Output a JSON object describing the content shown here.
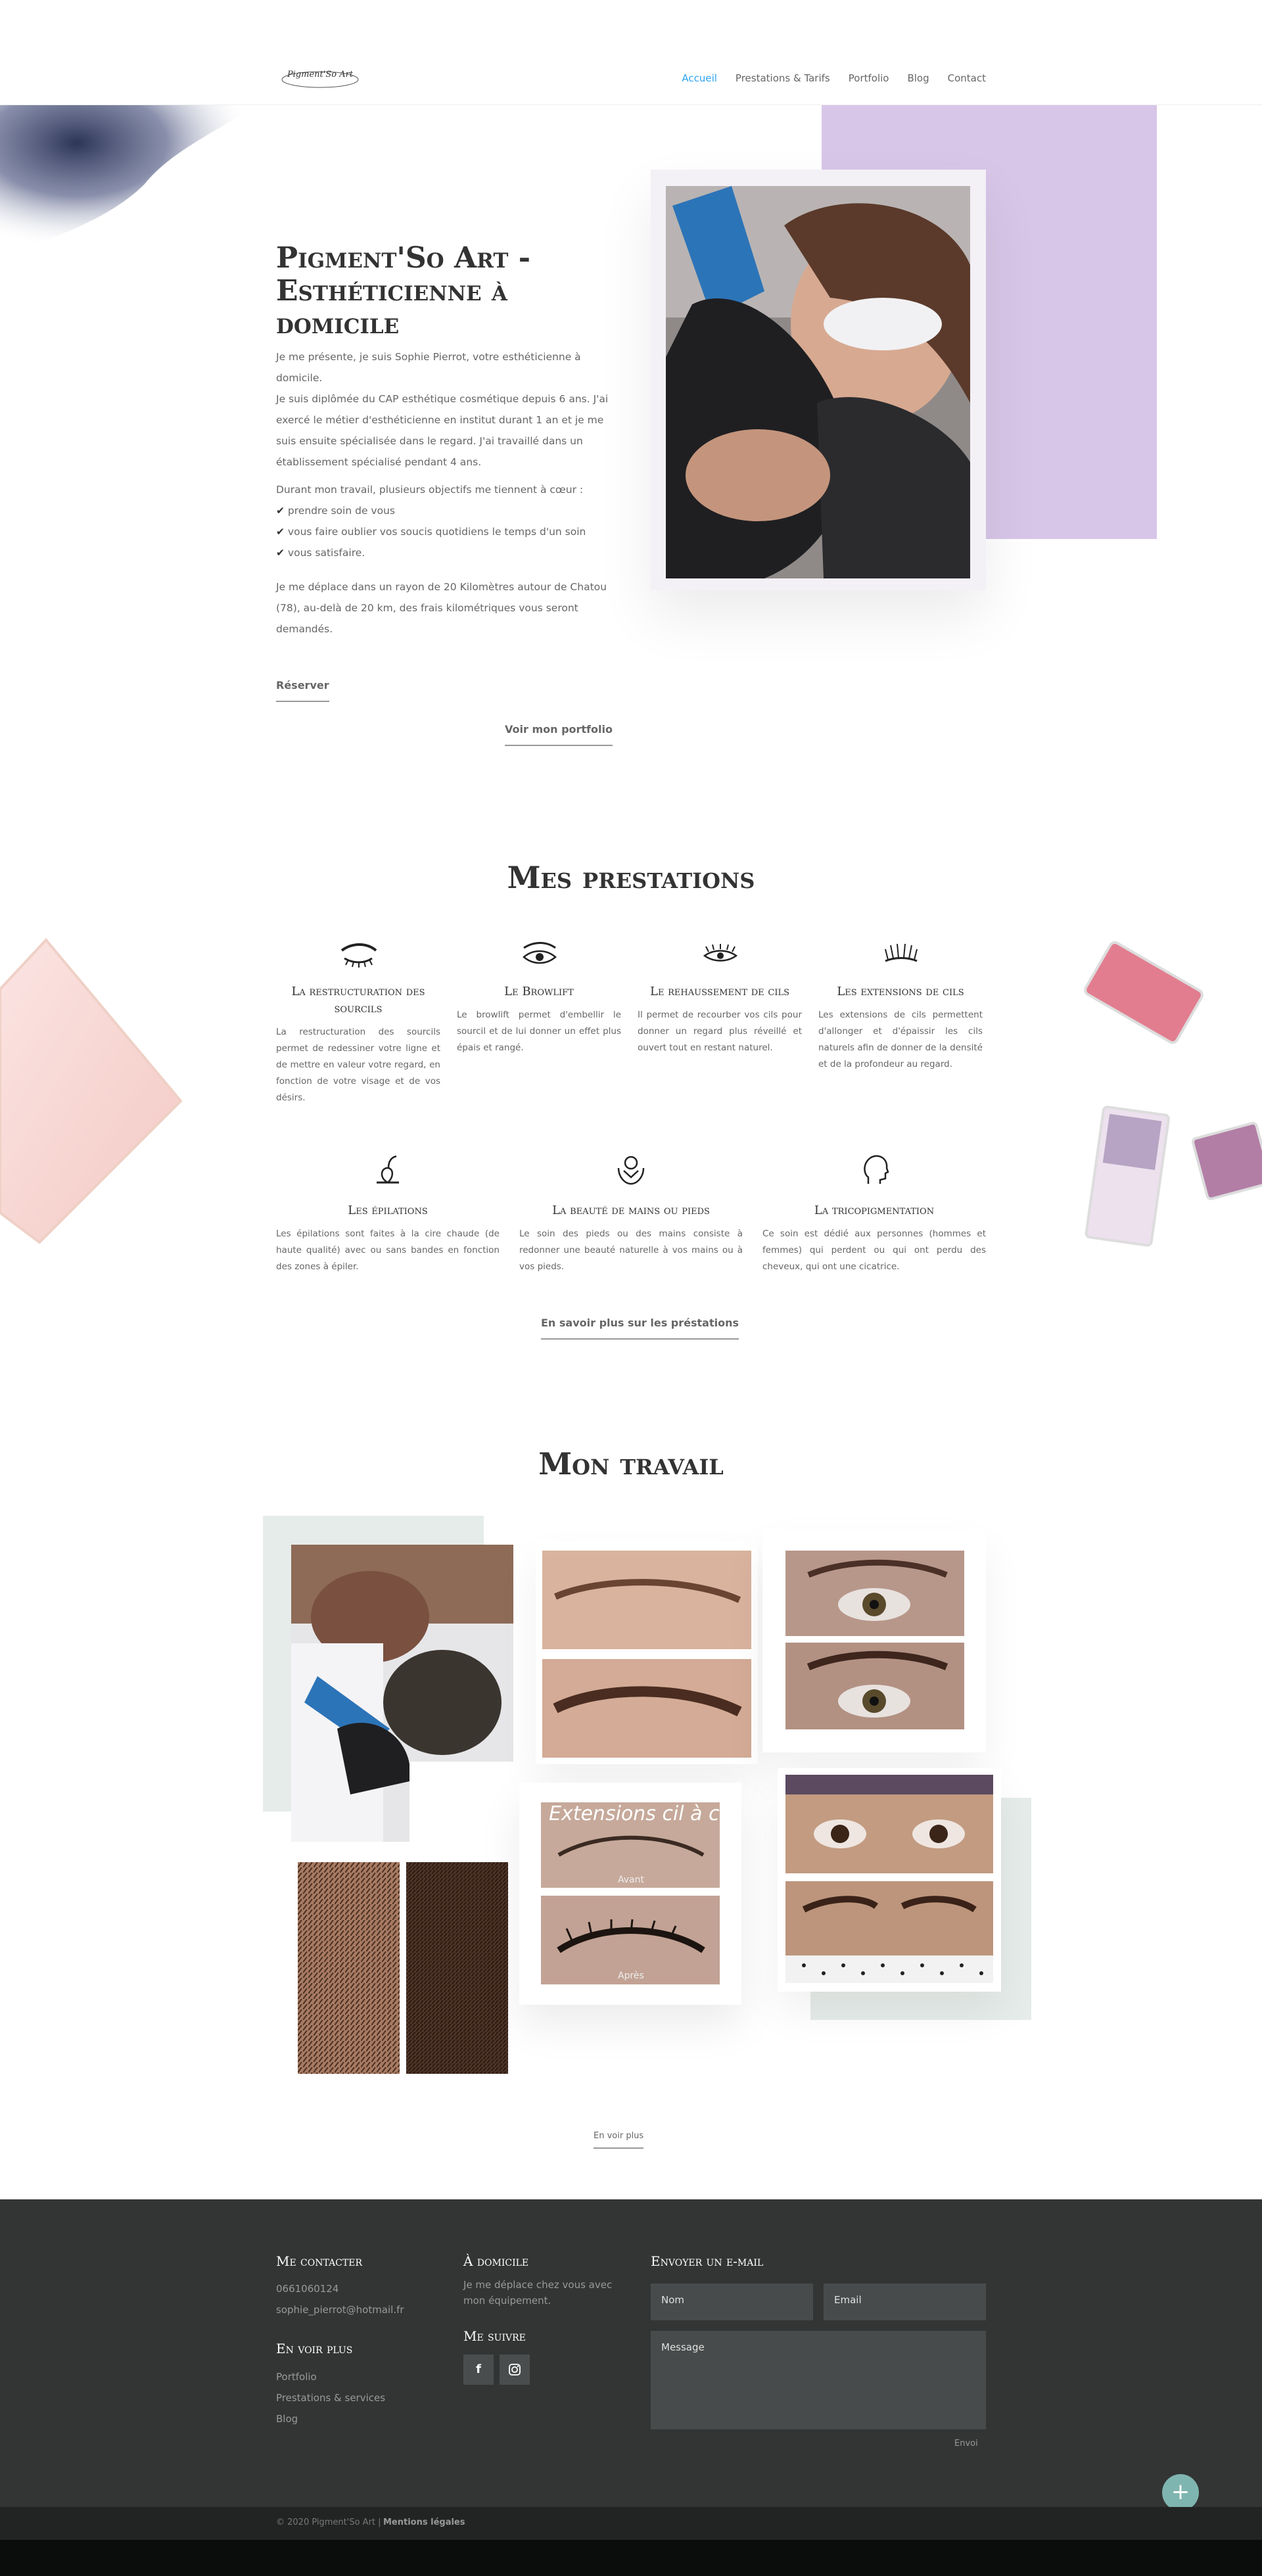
{
  "header": {
    "logo_text": "Pigment'So Art",
    "nav": [
      "Accueil",
      "Prestations & Tarifs",
      "Portfolio",
      "Blog",
      "Contact"
    ]
  },
  "hero": {
    "title": "Pigment'So Art - Esthéticienne à domicile",
    "intro_1": "Je me présente, je suis Sophie Pierrot, votre esthéticienne à domicile.",
    "intro_2": "Je suis diplômée du CAP esthétique cosmétique depuis 6 ans. J'ai exercé le métier d'esthéticienne en institut durant 1 an et je me suis ensuite spécialisée dans le regard. J'ai travaillé dans un établissement spécialisé pendant 4 ans.",
    "goals_intro": "Durant mon travail, plusieurs objectifs me tiennent à cœur :",
    "goals": [
      "prendre soin de vous",
      "vous faire oublier vos soucis quotidiens le temps d'un soin",
      "vous satisfaire."
    ],
    "travel": "Je me déplace dans un rayon de 20 Kilomètres autour de Chatou (78), au-delà de 20 km, des frais kilométriques vous seront demandés.",
    "book_button": "Réserver",
    "portfolio_button": "Voir mon portfolio"
  },
  "services": {
    "title": "Mes prestations",
    "items": [
      {
        "icon": "eyebrow-icon",
        "title": "La restructuration des sourcils",
        "text": "La restructuration des sourcils permet de redessiner votre ligne et de mettre en valeur votre regard, en fonction de votre visage et de vos désirs."
      },
      {
        "icon": "eye-icon",
        "title": "Le Browlift",
        "text": "Le browlift permet d'embellir le sourcil et de lui donner un effet plus épais et rangé."
      },
      {
        "icon": "eyelash-icon",
        "title": "Le rehaussement de cils",
        "text": "Il permet de recourber vos cils pour donner un regard plus réveillé et ouvert tout en restant naturel."
      },
      {
        "icon": "lash-extension-icon",
        "title": "Les extensions de cils",
        "text": "Les extensions de cils permettent d'allonger et d'épaissir les cils naturels afin de donner de la densité et de la profondeur au regard."
      },
      {
        "icon": "hair-removal-icon",
        "title": "Les épilations",
        "text": "Les épilations sont faites à la cire chaude (de haute qualité) avec ou sans bandes en fonction des zones à épiler."
      },
      {
        "icon": "hands-feet-icon",
        "title": "La beauté de mains ou pieds",
        "text": "Le soin des pieds ou des mains consiste à redonner une beauté naturelle à vos mains ou à vos pieds."
      },
      {
        "icon": "head-profile-icon",
        "title": "La tricopigmentation",
        "text": "Ce soin est dédié aux personnes (hommes et femmes) qui perdent ou qui ont perdu des cheveux, qui ont une cicatrice."
      }
    ],
    "more_button": "En savoir plus sur les préstations"
  },
  "work": {
    "title": "Mon travail",
    "overlay_text": "Extensions cil à cil",
    "before_label": "Avant",
    "after_label": "Après",
    "more_button": "En voir plus"
  },
  "footer": {
    "contact_title": "Me contacter",
    "phone": "0661060124",
    "email": "sophie_pierrot@hotmail.fr",
    "more_title": "En voir plus",
    "links": [
      "Portfolio",
      "Prestations & services",
      "Blog"
    ],
    "home_title": "À domicile",
    "home_text": "Je me déplace chez vous avec mon équipement.",
    "follow_title": "Me suivre",
    "mail_title": "Envoyer un e-mail",
    "name_placeholder": "Nom",
    "email_placeholder": "Email",
    "message_placeholder": "Message",
    "send_button": "Envoi",
    "copyright": "© 2020 Pigment'So Art |",
    "legal": "Mentions légales"
  },
  "colors": {
    "accent": "#2ea3f2",
    "lilac": "#d8c6e8",
    "sage": "#e6ece9",
    "footer_bg": "#333535",
    "fab": "#7fb5b0"
  }
}
